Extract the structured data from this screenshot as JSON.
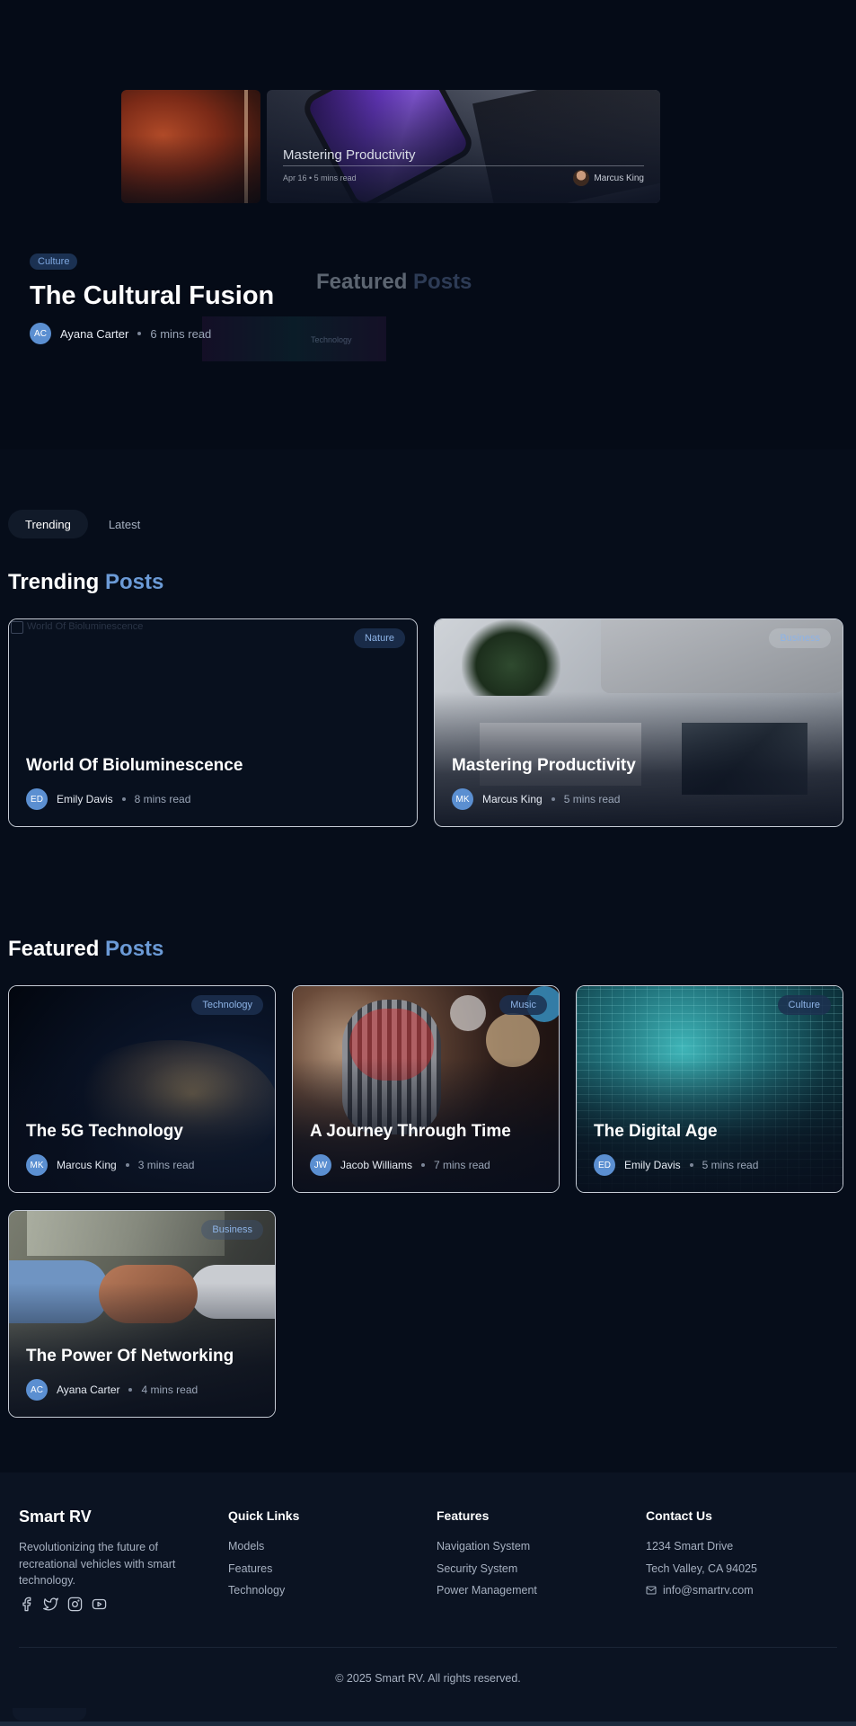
{
  "hero": {
    "slide_main": {
      "title": "Mastering Productivity",
      "meta": "Apr 16 • 5 mins read",
      "author": "Marcus King"
    },
    "ghost_title_primary": "Featured ",
    "ghost_title_accent": "Posts",
    "ghost_tag": "Technology",
    "active": {
      "category": "Culture",
      "title": "The Cultural Fusion",
      "author_initials": "AC",
      "author": "Ayana Carter",
      "read_time": "6 mins read"
    }
  },
  "tabs": [
    {
      "label": "Trending",
      "active": true
    },
    {
      "label": "Latest",
      "active": false
    }
  ],
  "trending": {
    "title_primary": "Trending ",
    "title_accent": "Posts",
    "posts": [
      {
        "title": "World Of Bioluminescence",
        "category": "Nature",
        "initials": "ED",
        "author": "Emily Davis",
        "read_time": "8 mins read",
        "image_alt": "World Of Bioluminescence"
      },
      {
        "title": "Mastering Productivity",
        "category": "Business",
        "initials": "MK",
        "author": "Marcus King",
        "read_time": "5 mins read"
      }
    ]
  },
  "featured": {
    "title_primary": "Featured ",
    "title_accent": "Posts",
    "posts": [
      {
        "title": "The 5G Technology",
        "category": "Technology",
        "initials": "MK",
        "author": "Marcus King",
        "read_time": "3 mins read"
      },
      {
        "title": "A Journey Through Time",
        "category": "Music",
        "initials": "JW",
        "author": "Jacob Williams",
        "read_time": "7 mins read"
      },
      {
        "title": "The Digital Age",
        "category": "Culture",
        "initials": "ED",
        "author": "Emily Davis",
        "read_time": "5 mins read"
      },
      {
        "title": "The Power Of Networking",
        "category": "Business",
        "initials": "AC",
        "author": "Ayana Carter",
        "read_time": "4 mins read"
      }
    ]
  },
  "footer": {
    "brand": "Smart RV",
    "description": "Revolutionizing the future of recreational vehicles with smart technology.",
    "socials": [
      "facebook-icon",
      "twitter-icon",
      "instagram-icon",
      "youtube-icon"
    ],
    "quick_links": {
      "heading": "Quick Links",
      "items": [
        "Models",
        "Features",
        "Technology"
      ]
    },
    "features": {
      "heading": "Features",
      "items": [
        "Navigation System",
        "Security System",
        "Power Management"
      ]
    },
    "contact": {
      "heading": "Contact Us",
      "address1": "1234 Smart Drive",
      "address2": "Tech Valley, CA 94025",
      "email": "info@smartrv.com"
    },
    "copyright": "© 2025 Smart RV. All rights reserved."
  },
  "colors": {
    "background": "#060d1a",
    "accent": "#6b9ad6",
    "avatar": "#5b8fd1",
    "tag_bg": "#1b3152",
    "footer_bg": "#0b1322"
  }
}
